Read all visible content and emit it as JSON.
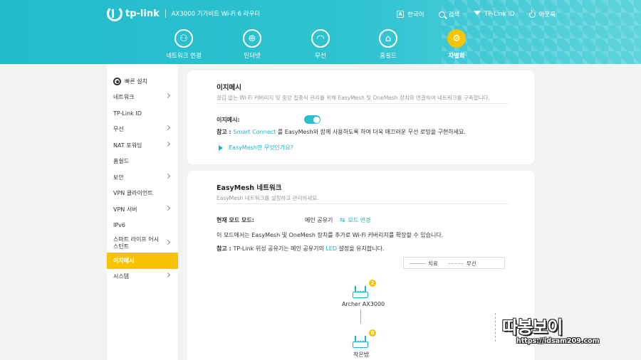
{
  "header": {
    "brand": "tp-link",
    "model": "AX3000 기가비트 Wi-Fi 6 라우터",
    "links": [
      {
        "label": "한국어",
        "icon": "language-icon"
      },
      {
        "label": "검색",
        "icon": "search-icon"
      },
      {
        "label": "TP-Link ID",
        "icon": "tplink-id-icon"
      },
      {
        "label": "아웃룩",
        "icon": "logout-icon"
      }
    ],
    "language_glyph": "A"
  },
  "nav": {
    "items": [
      {
        "label": "네트워크 연결",
        "icon": "network-map-icon",
        "glyph": "⚇"
      },
      {
        "label": "인터넷",
        "icon": "globe-icon",
        "glyph": "⊕"
      },
      {
        "label": "무선",
        "icon": "wifi-icon",
        "glyph": "◠"
      },
      {
        "label": "홈쉴드",
        "icon": "homeshield-icon",
        "glyph": "⌂"
      },
      {
        "label": "차별화",
        "icon": "advanced-gear-icon",
        "glyph": "⚙"
      }
    ],
    "active": "차별화",
    "active_color": "#f6c400"
  },
  "sidebar": {
    "items": [
      {
        "label": "빠른 설치"
      },
      {
        "label": "네트워크"
      },
      {
        "label": "TP-Link ID"
      },
      {
        "label": "무선"
      },
      {
        "label": "NAT 포워딩"
      },
      {
        "label": "홈쉴드"
      },
      {
        "label": "보안"
      },
      {
        "label": "VPN 클라이언트"
      },
      {
        "label": "VPN 서버"
      },
      {
        "label": "IPv6"
      },
      {
        "label": "스마트 라이프 어시\n스턴트"
      },
      {
        "label": "이지메시"
      },
      {
        "label": "시스템"
      }
    ],
    "active": "이지메시"
  },
  "easymesh": {
    "title": "이지메시",
    "description": "끊김 없는 Wi-Fi 커버리지 및 중앙 집중식 관리를 위해 EasyMesh 및 OneMesh 장치와 연결하여 네트워크를 구축합니다.",
    "toggle_label": "이지메시:",
    "toggle_on": true,
    "note_prefix": "참고 : ",
    "note_link": "Smart Connect",
    "note_suffix": " 를 EasyMesh와 함께 사용하도록 하여 더욱 매끄러운 무선 로밍을 구현하세요.",
    "help_link": "EasyMesh란 무엇인가요?"
  },
  "network": {
    "title": "EasyMesh 네트워크",
    "description": "EasyMesh 네트워크를 설정하고 관리하세요.",
    "mode_label": "현재 모드 모드:",
    "mode_value": "메인 공유기",
    "mode_change": "모드 변경",
    "mode_info": "이 모드에서는 EasyMesh 및 OneMesh 장치를 추가로 Wi-Fi 커버리지를 확장할 수 있습니다.",
    "note_prefix": "참고 : ",
    "note_text": "TP-Link 위성 공유기는 메인 공유기의 ",
    "note_link": "LED",
    "note_suffix": " 설정을 유지합니다.",
    "legend_wired": "치료",
    "legend_wireless": "무선",
    "main_router": {
      "name": "Archer AX3000",
      "count": "2"
    },
    "satellite": {
      "name": "작은방",
      "count": "0"
    }
  },
  "watermark": {
    "title": "따봉보이",
    "url": "https://idsam209.com"
  },
  "colors": {
    "accent": "#1bb3c7",
    "header": "#2ec3d1",
    "active": "#f6c400"
  }
}
